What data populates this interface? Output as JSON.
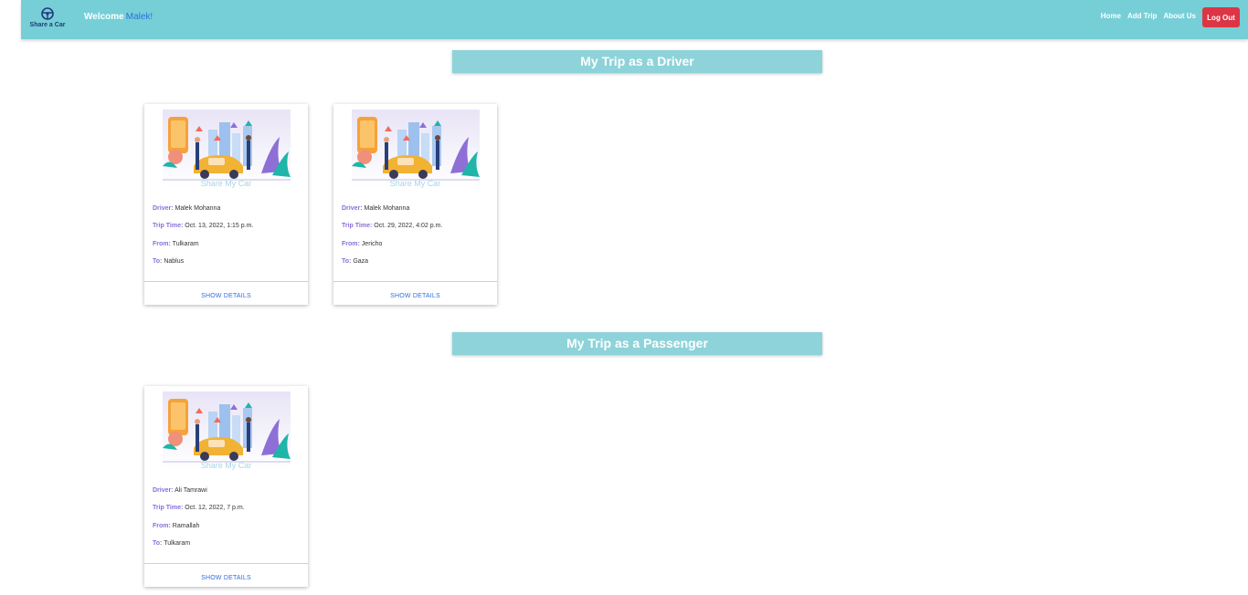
{
  "navbar": {
    "brand_label": "Share a Car",
    "welcome_prefix": "Welcome",
    "welcome_name": "Malek!",
    "links": [
      "Home",
      "Add Trip",
      "About Us"
    ],
    "logout_label": "Log Out"
  },
  "sections": {
    "driver_title": "My Trip as a Driver",
    "passenger_title": "My Trip as a Passenger"
  },
  "labels": {
    "driver": "Driver:",
    "time": "Trip Time:",
    "from": "From:",
    "to": "To:",
    "caption": "Share My Car",
    "details": "SHOW DETAILS"
  },
  "driver_trips": [
    {
      "driver": "Malek Mohanna",
      "time": "Oct. 13, 2022, 1:15 p.m.",
      "from": "Tulkaram",
      "to": "Nablus"
    },
    {
      "driver": "Malek Mohanna",
      "time": "Oct. 29, 2022, 4:02 p.m.",
      "from": "Jericho",
      "to": "Gaza"
    }
  ],
  "passenger_trips": [
    {
      "driver": "Ali Tamrawi",
      "time": "Oct. 12, 2022, 7 p.m.",
      "from": "Ramallah",
      "to": "Tulkaram"
    }
  ],
  "colors": {
    "navbar": "#76cfd6",
    "section_header": "#8dd3d9",
    "logout": "#dc3545",
    "label": "#8a6fd8",
    "link": "#2f6fe0"
  }
}
